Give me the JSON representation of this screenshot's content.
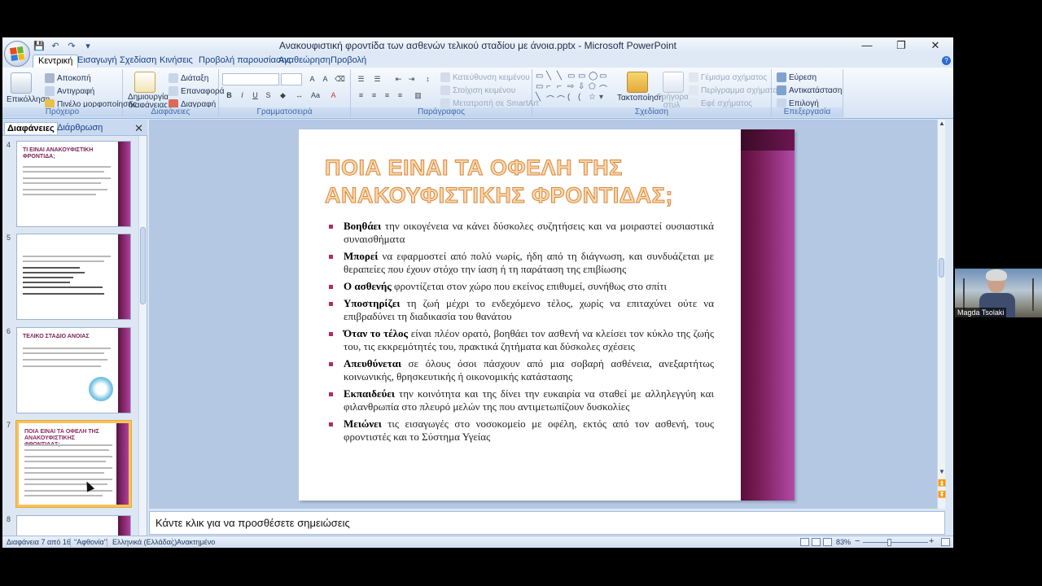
{
  "window": {
    "title": "Ανακουφιστική φροντίδα των ασθενών τελικού σταδίου με άνοια.pptx - Microsoft PowerPoint",
    "minimize": "—",
    "restore": "❐",
    "close": "✕"
  },
  "qat": {
    "save": "💾",
    "undo": "↶",
    "redo": "↷",
    "more": "▾"
  },
  "tabs": [
    "Κεντρική",
    "Εισαγωγή",
    "Σχεδίαση",
    "Κινήσεις",
    "Προβολή παρουσίασης",
    "Αναθεώρηση",
    "Προβολή"
  ],
  "ribbon": {
    "clipboard": {
      "paste": "Επικόλληση",
      "cut": "Αποκοπή",
      "copy": "Αντιγραφή",
      "format_painter": "Πινέλο μορφοποίησης",
      "label": "Πρόχειρο"
    },
    "slides": {
      "new_slide": "Δημιουργία διαφάνειας",
      "layout": "Διάταξη",
      "reset": "Επαναφορά",
      "delete": "Διαγραφή",
      "label": "Διαφάνειες"
    },
    "font": {
      "label": "Γραμματοσειρά"
    },
    "paragraph": {
      "text_direction": "Κατεύθυνση κειμένου",
      "align_text": "Στοίχιση κειμένου",
      "smartart": "Μετατροπή σε SmartArt",
      "label": "Παράγραφος"
    },
    "drawing": {
      "arrange": "Τακτοποίηση",
      "quick_styles": "Γρήγορα στυλ",
      "shape_fill": "Γέμισμα σχήματος",
      "shape_outline": "Περίγραμμα σχήματος",
      "shape_effects": "Εφέ σχήματος",
      "label": "Σχεδίαση"
    },
    "editing": {
      "find": "Εύρεση",
      "replace": "Αντικατάσταση",
      "select": "Επιλογή",
      "label": "Επεξεργασία"
    }
  },
  "left_pane": {
    "tab_slides": "Διαφάνειες",
    "tab_outline": "Διάρθρωση",
    "close": "✕",
    "thumbs": [
      {
        "num": "4",
        "title": "ΤΙ ΕΙΝΑΙ ΑΝΑΚΟΥΦΙΣΤΙΚΗ ΦΡΟΝΤΙΔΑ;"
      },
      {
        "num": "5",
        "title": ""
      },
      {
        "num": "6",
        "title": "ΤΕΛΙΚΟ ΣΤΑΔΙΟ ΑΝΟΙΑΣ"
      },
      {
        "num": "7",
        "title": "ΠΟΙΑ ΕΙΝΑΙ ΤΑ ΟΦΕΛΗ ΤΗΣ ΑΝΑΚΟΥΦΙΣΤΙΚΗΣ ΦΡΟΝΤΙΔΑΣ;"
      },
      {
        "num": "8",
        "title": ""
      }
    ]
  },
  "slide": {
    "title": "ΠΟΙΑ ΕΙΝΑΙ ΤΑ ΟΦΕΛΗ ΤΗΣ ΑΝΑΚΟΥΦΙΣΤΙΚΗΣ ΦΡΟΝΤΙΔΑΣ;",
    "bullets": [
      {
        "bold": "Βοηθάει",
        "text": " την οικογένεια να κάνει δύσκολες συζητήσεις και να μοιραστεί ουσιαστικά συναισθήματα"
      },
      {
        "bold": "Μπορεί",
        "text": " να εφαρμοστεί από πολύ νωρίς, ήδη από τη διάγνωση, και συνδυάζεται με θεραπείες που έχουν στόχο την ίαση ή τη παράταση της επιβίωσης"
      },
      {
        "bold": "Ο ασθενής",
        "text": " φροντίζεται στον χώρο που εκείνος επιθυμεί, συνήθως στο σπίτι"
      },
      {
        "bold": "Υποστηρίζει",
        "text": " τη ζωή μέχρι το ενδεχόμενο τέλος, χωρίς να επιταχύνει ούτε να επιβραδύνει τη διαδικασία του θανάτου"
      },
      {
        "bold": "Όταν το τέλος",
        "text": " είναι πλέον ορατό, βοηθάει τον ασθενή να κλείσει τον κύκλο της ζωής του, τις εκκρεμότητές του, πρακτικά ζητήματα και δύσκολες σχέσεις"
      },
      {
        "bold": "Απευθύνεται",
        "text": " σε όλους όσοι πάσχουν από μια σοβαρή ασθένεια, ανεξαρτήτως κοινωνικής, θρησκευτικής ή οικονομικής κατάστασης"
      },
      {
        "bold": "Εκπαιδεύει",
        "text": " την κοινότητα και της δίνει την ευκαιρία να σταθεί με αλληλεγγύη και φιλανθρωπία στο πλευρό μελών της που αντιμετωπίζουν δυσκολίες"
      },
      {
        "bold": "Μειώνει",
        "text": " τις εισαγωγές στο νοσοκομείο με οφέλη, εκτός από τον ασθενή, τους φροντιστές και το Σύστημα Υγείας"
      }
    ]
  },
  "notes": {
    "placeholder": "Κάντε κλικ για να προσθέσετε σημειώσεις"
  },
  "status": {
    "slide_pos": "Διαφάνεια 7 από 16",
    "theme": "\"Αφθονία\"",
    "language": "Ελληνικά (Ελλάδας)",
    "mode": "Ανακτημένο",
    "zoom": "83%",
    "zoom_out": "−",
    "zoom_in": "+"
  },
  "webcam": {
    "name": "Magda Tsolaki"
  },
  "colors": {
    "accent": "#15428b",
    "slide_bar": "#7a1d57",
    "bullet": "#b02c63",
    "title_fill": "#fbd7a8",
    "title_stroke": "#d7873f"
  }
}
